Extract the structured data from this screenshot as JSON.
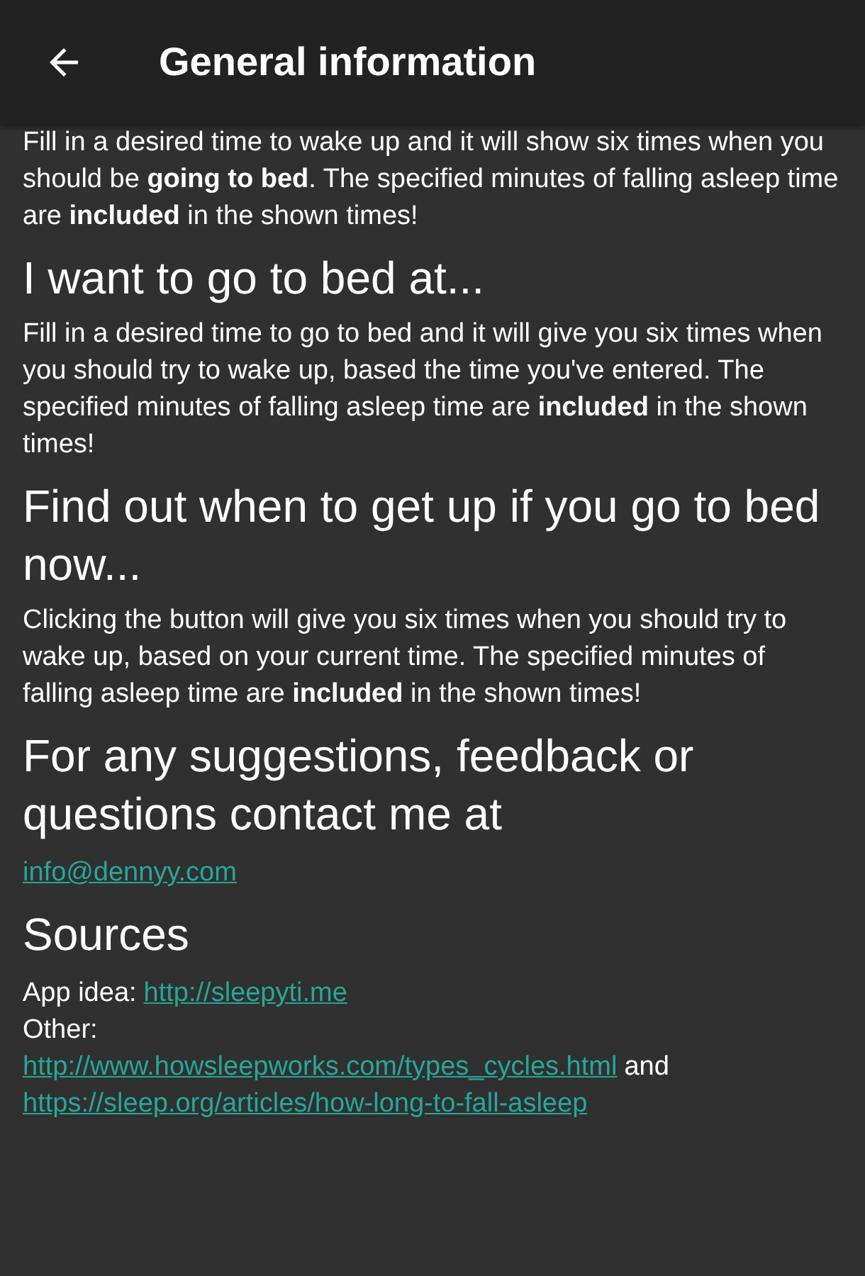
{
  "app_bar": {
    "title": "General information"
  },
  "sections": [
    {
      "paragraph": "Fill in a desired time to wake up and it will show six times when you should be **going to bed**. The specified minutes of falling asleep time are **included** in the shown times!"
    },
    {
      "heading": "I want to go to bed at...",
      "paragraph": "Fill in a desired time to go to bed and it will give you six times when you should try to wake up, based the time you've entered. The specified minutes of falling asleep time are **included** in the shown times!"
    },
    {
      "heading": "Find out when to get up if you go to bed now...",
      "paragraph": "Clicking the button will give you six times when you should try to wake up, based on your current time. The specified minutes of falling asleep time are **included** in the shown times!"
    },
    {
      "heading": "For any suggestions, feedback or questions contact me at",
      "lines": [
        [
          {
            "kind": "link",
            "text": "info@dennyy.com"
          }
        ]
      ]
    },
    {
      "heading": "Sources",
      "lines": [
        [
          {
            "kind": "text",
            "text": "App idea:"
          },
          {
            "kind": "link",
            "text": "http://sleepyti.me"
          }
        ],
        [
          {
            "kind": "text",
            "text": "Other:"
          }
        ],
        [
          {
            "kind": "link",
            "text": "http://www.howsleepworks.com/types_cycles.html"
          },
          {
            "kind": "text",
            "text": "and"
          }
        ],
        [
          {
            "kind": "link",
            "text": "https://sleep.org/articles/how-long-to-fall-asleep"
          }
        ]
      ]
    }
  ]
}
